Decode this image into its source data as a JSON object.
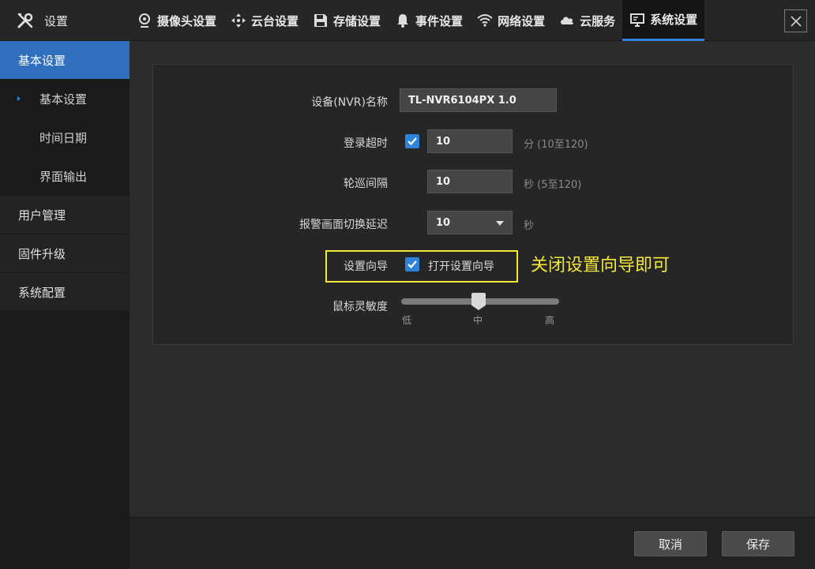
{
  "app": {
    "title": "设置"
  },
  "tabs": [
    {
      "label": "摄像头设置",
      "icon": "camera-icon"
    },
    {
      "label": "云台设置",
      "icon": "ptz-icon"
    },
    {
      "label": "存储设置",
      "icon": "save-icon"
    },
    {
      "label": "事件设置",
      "icon": "bell-icon"
    },
    {
      "label": "网络设置",
      "icon": "wifi-icon"
    },
    {
      "label": "云服务",
      "icon": "cloud-icon"
    },
    {
      "label": "系统设置",
      "icon": "monitor-icon",
      "active": true
    }
  ],
  "sidebar": {
    "items": [
      {
        "label": "基本设置",
        "active": true
      },
      {
        "label": "用户管理"
      },
      {
        "label": "固件升级"
      },
      {
        "label": "系统配置"
      }
    ],
    "subitems": [
      {
        "label": "基本设置",
        "selected": true
      },
      {
        "label": "时间日期"
      },
      {
        "label": "界面输出"
      }
    ]
  },
  "form": {
    "device_name": {
      "label": "设备(NVR)名称",
      "value": "TL-NVR6104PX 1.0"
    },
    "login_timeout": {
      "label": "登录超时",
      "checked": true,
      "value": "10",
      "hint": "分 (10至120)"
    },
    "patrol_interval": {
      "label": "轮巡间隔",
      "value": "10",
      "hint": "秒 (5至120)"
    },
    "alarm_delay": {
      "label": "报警画面切换延迟",
      "value": "10",
      "unit": "秒"
    },
    "wizard": {
      "label": "设置向导",
      "checked": true,
      "option": "打开设置向导"
    },
    "mouse_sensitivity": {
      "label": "鼠标灵敏度",
      "level": 0.5,
      "ticks": [
        "低",
        "中",
        "高"
      ]
    }
  },
  "annotation": {
    "text": "关闭设置向导即可",
    "color": "#f1e83a"
  },
  "footer": {
    "cancel_label": "取消",
    "save_label": "保存"
  },
  "colors": {
    "accent": "#2f82d9",
    "sidebar_active": "#2f6fbd",
    "highlight": "#f1e83a"
  }
}
